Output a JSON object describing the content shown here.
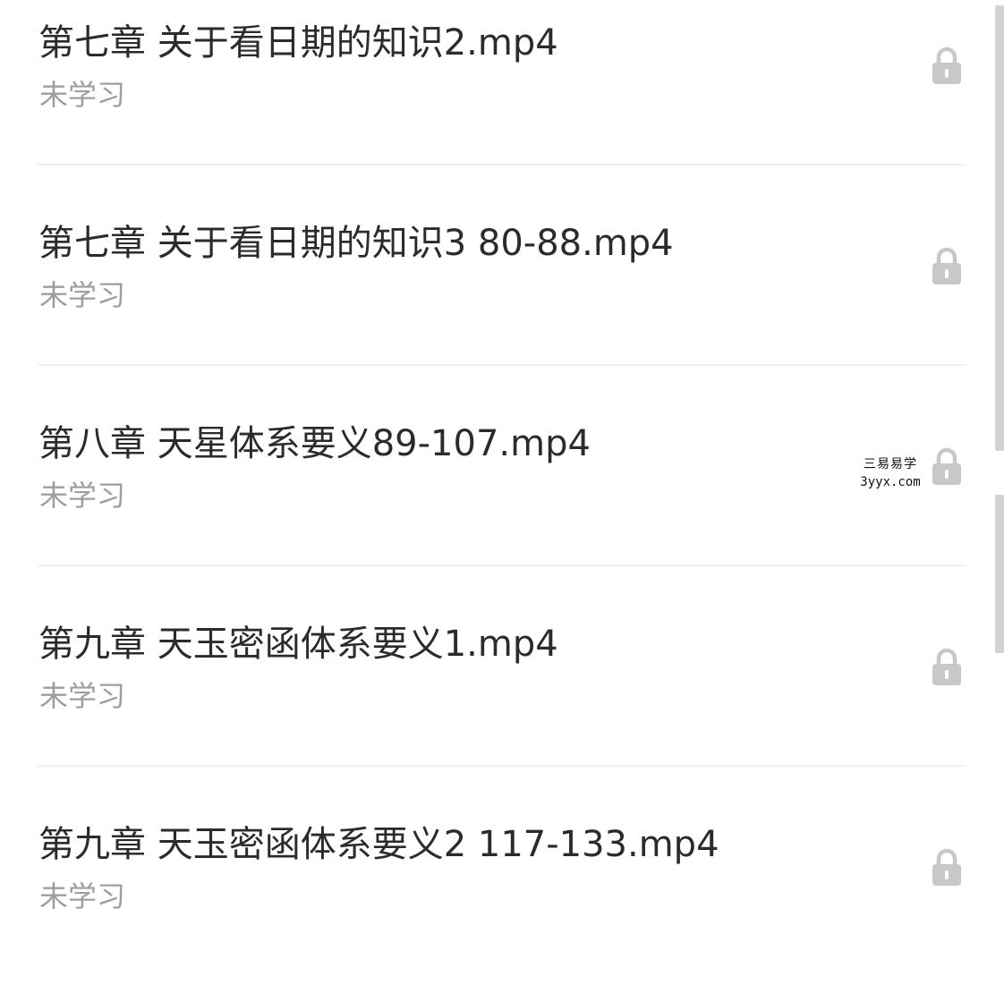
{
  "lessons": [
    {
      "title": "第七章 关于看日期的知识2.mp4",
      "status": "未学习",
      "icon": "lock-icon"
    },
    {
      "title": "第七章 关于看日期的知识3 80-88.mp4",
      "status": "未学习",
      "icon": "lock-icon"
    },
    {
      "title": "第八章 天星体系要义89-107.mp4",
      "status": "未学习",
      "icon": "lock-icon"
    },
    {
      "title": "第九章 天玉密函体系要义1.mp4",
      "status": "未学习",
      "icon": "lock-icon"
    },
    {
      "title": "第九章 天玉密函体系要义2 117-133.mp4",
      "status": "未学习",
      "icon": "lock-icon"
    }
  ],
  "watermark": {
    "name": "三易易学",
    "site": "3yyx.com"
  },
  "colors": {
    "title": "#2b2b2b",
    "status": "#9e9e9e",
    "lock": "#c8c8c8",
    "divider": "#efefef",
    "scrollbar": "#d2d2d2"
  }
}
